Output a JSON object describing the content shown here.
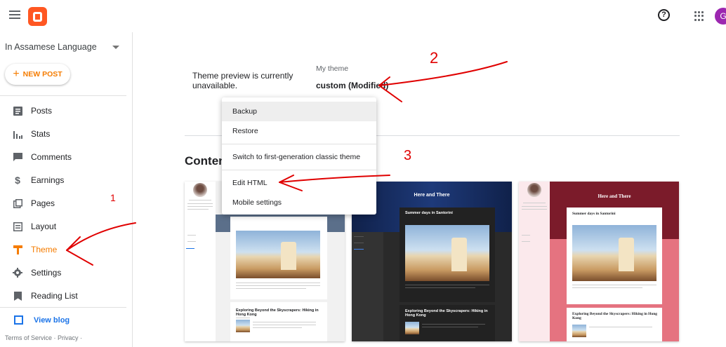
{
  "header": {
    "menu_icon": "hamburger-menu-icon",
    "logo_icon": "blogger-logo-icon",
    "help_icon": "help-circle-icon",
    "help_glyph": "?",
    "apps_icon": "apps-grid-icon",
    "avatar_initial": "G",
    "brand_color": "#ff5722",
    "avatar_color": "#9c27b0"
  },
  "sidebar": {
    "blog_name": "In Assamese Language",
    "new_post_plus": "+",
    "new_post_label": "NEW POST",
    "items": [
      {
        "label": "Posts",
        "icon": "posts-icon"
      },
      {
        "label": "Stats",
        "icon": "stats-icon"
      },
      {
        "label": "Comments",
        "icon": "comments-icon"
      },
      {
        "label": "Earnings",
        "icon": "earnings-icon"
      },
      {
        "label": "Pages",
        "icon": "pages-icon"
      },
      {
        "label": "Layout",
        "icon": "layout-icon"
      },
      {
        "label": "Theme",
        "icon": "theme-icon",
        "active": true
      },
      {
        "label": "Settings",
        "icon": "settings-icon"
      },
      {
        "label": "Reading List",
        "icon": "reading-list-icon"
      }
    ],
    "view_blog": "View blog",
    "footer": "Terms of Service · Privacy ·",
    "accent_color": "#f57c00"
  },
  "main": {
    "preview_unavailable": "Theme preview is currently unavailable.",
    "my_theme_label": "My theme",
    "my_theme_name": "custom (Modified)",
    "content_title": "Conten",
    "menu": {
      "backup": "Backup",
      "restore": "Restore",
      "switch_classic": "Switch to first-generation classic theme",
      "edit_html": "Edit HTML",
      "mobile_settings": "Mobile settings"
    },
    "thumbnails": [
      {
        "post_title": "Exploring Beyond the Skyscrapers: Hiking in Hong Kong"
      },
      {
        "blog_title": "Here and There",
        "post_title": "Summer days in Santorini",
        "post_title_2": "Exploring Beyond the Skyscrapers: Hiking in Hong Kong"
      },
      {
        "blog_title": "Here and There",
        "post_title": "Summer days in Santorini",
        "post_title_2": "Exploring Beyond the Skyscrapers: Hiking in Hong Kong"
      }
    ]
  },
  "annotations": {
    "mark_1": "1",
    "mark_2": "2",
    "mark_3": "3",
    "ink_color": "#e00000"
  }
}
